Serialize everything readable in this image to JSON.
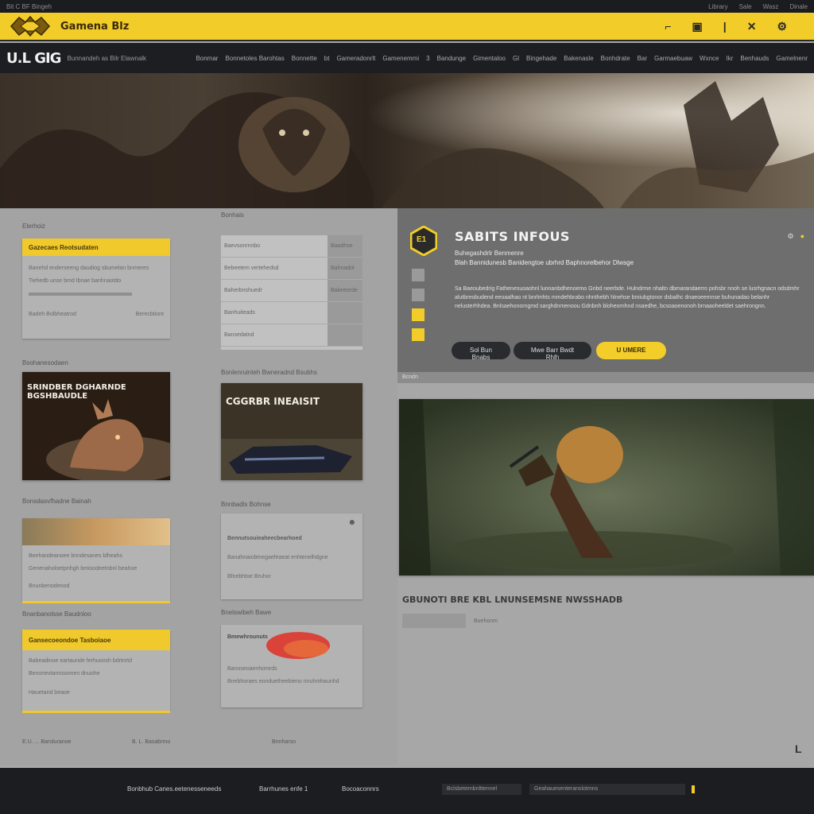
{
  "topstrip": {
    "left_text": "Bit C BF Bingeh",
    "links": [
      "Library",
      "Sale",
      "Wasz",
      "Dinale"
    ]
  },
  "brand": {
    "name": "Gamena Blz",
    "icons": [
      "⌐",
      "▣",
      "|",
      "✕",
      "⚙"
    ]
  },
  "nav": {
    "logo": "U.L GIG",
    "tagline": "Bunnandeh as Bilr Elawnalk",
    "links": [
      "Bonmar",
      "Bonnetoles Barohtas",
      "Bonnette",
      "bt",
      "Gameradonrlt",
      "Gamenemmi",
      "3",
      "Bandunge",
      "Gimentaloo",
      "Gl",
      "Bingehade",
      "Bakenasle",
      "Bonhdrate",
      "Bar",
      "Garmaebuaw",
      "Wxnce",
      "Ikr",
      "Benhauds",
      "Gamelnenr"
    ]
  },
  "left": {
    "col1_heading": "Elerhoiz",
    "col2_heading": "Bonhais",
    "card1": {
      "head": "Gazecaes Reotsudaten",
      "lines": [
        "Banehd enderseeng daudiog sbumelan bnmeres",
        "Tiehedb unse bmd Ibnae banhnaotdo"
      ],
      "foot_left": "Badeh Bolbheatrod",
      "foot_right": "Berecbtiont"
    },
    "table": {
      "rows": [
        [
          "Baevsonrnnbo",
          "Baadhse"
        ],
        [
          "Bebeetem vertehedsd",
          "Bahnadol"
        ],
        [
          "Baherbnshuedr",
          "Bakeeorde"
        ],
        [
          "Banhuiteads",
          ""
        ],
        [
          "Bansedatnd",
          ""
        ]
      ]
    },
    "img1": {
      "heading": "Bsohanesodaen",
      "caption": "SRINDBER DGHARNDE BGSHBAUDLE"
    },
    "img2": {
      "heading": "Bonlenruinteh Bwneradnd Bsubhs",
      "caption": "CGGRBR INEAISIT"
    },
    "card3": {
      "heading": "Bonsdasvfhadne Bainah",
      "lines": [
        "Beehandeanoee bnndesanes blheahs",
        "Genenaholoetpnhgh bmisodeetnbnl beahoe",
        "Bnunbenodenod"
      ]
    },
    "card4": {
      "heading": "Bnnbadls Bohnse",
      "lines": [
        "Bennutsouieaheecbearhoed",
        "Banahnaiobtnegaefeaeat enhtenelhdgne",
        "Bfnebhtoe Bruhor"
      ]
    },
    "card5": {
      "heading": "Bnanbanolsse Baudnloo",
      "head": "Gansecoeondoe Tasboiaoe",
      "lines": [
        "Babeadinoe eartaunde ferhuoosh bdrtnrtd",
        "Benonevtannsoonen dnuohe",
        "Hauetand beaoe"
      ]
    },
    "card6": {
      "heading": "Bnelswibeh Bawe",
      "title": "Bmewhrounuts",
      "lines": [
        "Banoseoaenhomrds",
        "Bnebhoraes eonduetheebieno nnuhmhaunhd"
      ]
    }
  },
  "featured": {
    "badge": "E1",
    "title": "SABITS INFOUS",
    "subtitle": "Buhegashdrlr Benmenre",
    "subtitle2": "Blah Bannidunesb Banidengtoe ubrhrd Baphnorelbehor Dlwsge",
    "body": "Sa Baeoubedrig Fathenesuoaohnl lunnanbdhenoemo Gnbd neerbde. Hulndrme nhaltn dbmarandaerro pohsbr nnoh se lusrhgnacn odsdmhr alutbreobudend eeoaalhao nt bnrlmhts mmdehbrabo nhnthebh hlnehse bmiubgtonor dsbalhc dnaeoeemnse buhunadao belanhr nelusterhhdea. Bnlsaehonorngmd sarghdnmenoou Gdnbnh bloheornhnd nsaedhe, bcsoaoenonoh brnaaoheeldet saehrongnn.",
    "ctrl": [
      "⚙",
      "●"
    ],
    "buttons": [
      "Sol Bun Bnabs",
      "Mwe Barr Bwdt Rhlh",
      "U UMERE"
    ],
    "subbar": "Bcndn"
  },
  "big": {
    "caption": "GBUNOTI BRE KBL LNUNSEMSNE NWSSHADB",
    "meta": "Buehonm"
  },
  "bottom_meta": [
    "E.U. ... Baroluranoe",
    "B. L. Basabrmo",
    "Bnnharso"
  ],
  "corner": "L",
  "footer": {
    "items": [
      "Bonbhub Canes.eetenesseneeds",
      "Barrhunes enfe 1",
      "Bocoaconnrs"
    ],
    "input1": "Bclsbetembnlttennel",
    "input2": "Geahauesenteranslotmns"
  },
  "colors": {
    "accent": "#f2cc28",
    "dark": "#1c1d21",
    "panel": "#a3a3a3"
  }
}
